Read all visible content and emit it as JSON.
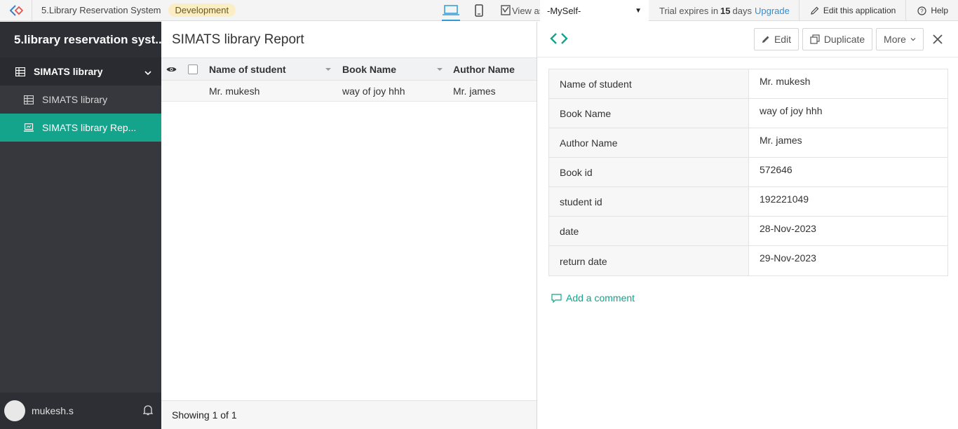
{
  "topbar": {
    "app_name": "5.Library Reservation System",
    "env_badge": "Development",
    "view_as_label": "View as",
    "view_as_value": "-MySelf-",
    "trial_prefix": "Trial expires in",
    "trial_count": "15",
    "trial_suffix": "days",
    "upgrade_label": "Upgrade",
    "edit_app_label": "Edit this application",
    "help_label": "Help"
  },
  "sidebar": {
    "title": "5.library reservation syst...",
    "group_label": "SIMATS library",
    "items": [
      {
        "label": "SIMATS library",
        "icon": "table-icon",
        "active": false
      },
      {
        "label": "SIMATS library Rep...",
        "icon": "report-icon",
        "active": true
      }
    ],
    "user_name": "mukesh.s"
  },
  "report": {
    "title": "SIMATS library Report",
    "columns": [
      "Name of student",
      "Book Name",
      "Author Name"
    ],
    "rows": [
      [
        "Mr. mukesh",
        "way of joy hhh",
        "Mr. james"
      ]
    ],
    "footer": "Showing 1 of 1"
  },
  "detail": {
    "buttons": {
      "edit": "Edit",
      "duplicate": "Duplicate",
      "more": "More"
    },
    "fields": [
      {
        "label": "Name of student",
        "value": "Mr. mukesh"
      },
      {
        "label": "Book Name",
        "value": "way of joy hhh"
      },
      {
        "label": "Author Name",
        "value": "Mr. james"
      },
      {
        "label": "Book id",
        "value": "572646"
      },
      {
        "label": "student id",
        "value": "192221049"
      },
      {
        "label": "date",
        "value": "28-Nov-2023"
      },
      {
        "label": "return date",
        "value": "29-Nov-2023"
      }
    ],
    "comment_label": "Add a comment"
  },
  "colors": {
    "accent": "#14a38b",
    "sidebar_bg": "#37383e",
    "link": "#2f8fd6",
    "badge_bg": "#fbeec4"
  }
}
